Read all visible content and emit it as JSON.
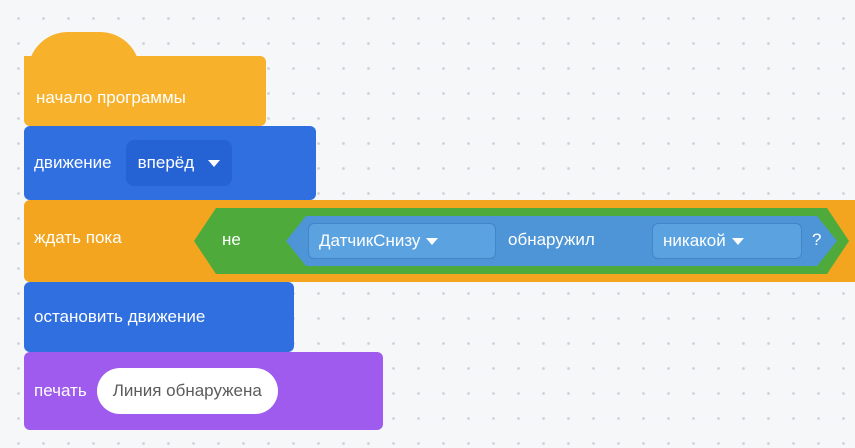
{
  "blocks": {
    "start": {
      "label": "начало программы"
    },
    "move": {
      "label": "движение",
      "direction": "вперёд"
    },
    "wait": {
      "label": "ждать пока",
      "not_label": "не",
      "sensor": "ДатчикСнизу",
      "detected_label": "обнаружил",
      "object": "никакой",
      "question": "?"
    },
    "stop": {
      "label": "остановить движение"
    },
    "print": {
      "label": "печать",
      "text": "Линия обнаружена"
    }
  },
  "colors": {
    "event": "#f7b12a",
    "motion": "#2f6fe0",
    "control": "#f3a51f",
    "operator": "#4eaa3b",
    "sensing": "#4d95d6",
    "looks": "#9e5bed"
  }
}
